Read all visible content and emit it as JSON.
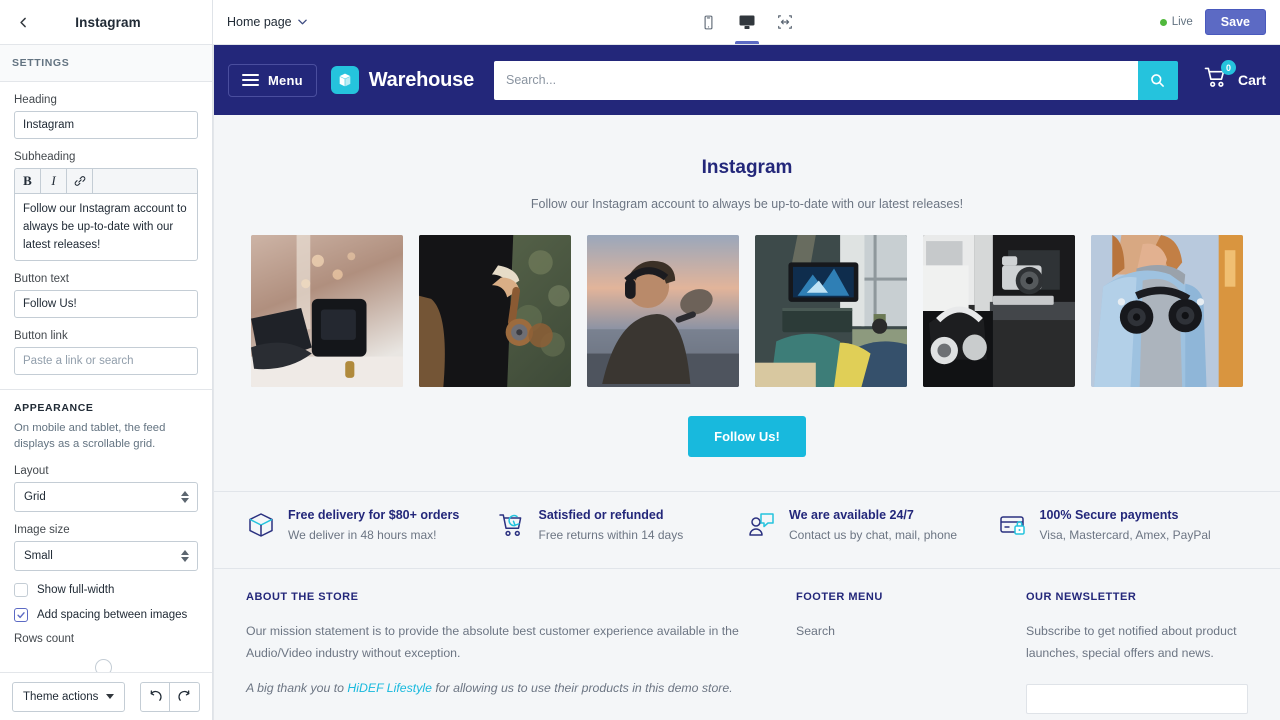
{
  "sidebar": {
    "back_icon": "chevron-left-icon",
    "title": "Instagram",
    "section_label": "SETTINGS",
    "heading": {
      "label": "Heading",
      "value": "Instagram"
    },
    "subheading": {
      "label": "Subheading",
      "toolbar": [
        {
          "name": "bold-button",
          "glyph": "B"
        },
        {
          "name": "italic-button",
          "glyph": "I"
        },
        {
          "name": "link-button",
          "glyph": "link-icon"
        }
      ],
      "value": "Follow our Instagram account to always be up-to-date with our latest releases!"
    },
    "button_text": {
      "label": "Button text",
      "value": "Follow Us!"
    },
    "button_link": {
      "label": "Button link",
      "value": "",
      "placeholder": "Paste a link or search"
    },
    "appearance": {
      "label": "APPEARANCE",
      "help": "On mobile and tablet, the feed displays as a scrollable grid.",
      "layout": {
        "label": "Layout",
        "value": "Grid"
      },
      "image_size": {
        "label": "Image size",
        "value": "Small"
      },
      "show_full_width": {
        "label": "Show full-width",
        "checked": false
      },
      "add_spacing": {
        "label": "Add spacing between images",
        "checked": true
      },
      "rows_count": {
        "label": "Rows count"
      }
    },
    "footer": {
      "theme_actions": "Theme actions",
      "undo": "undo-icon",
      "redo": "redo-icon"
    }
  },
  "topbar": {
    "page_picker": "Home page",
    "devices": [
      {
        "name": "mobile",
        "active": false
      },
      {
        "name": "desktop",
        "active": true
      },
      {
        "name": "full-width",
        "active": false
      }
    ],
    "live_label": "Live",
    "live_color": "#50b83c",
    "save_label": "Save",
    "save_color": "#5c6ac4"
  },
  "store": {
    "header": {
      "bg_color": "#23277a",
      "accent_color": "#25c3dd",
      "menu_label": "Menu",
      "brand_name": "Warehouse",
      "search_placeholder": "Search...",
      "search_value": "",
      "cart_label": "Cart",
      "cart_count": "0"
    },
    "instagram": {
      "title": "Instagram",
      "subtitle": "Follow our Instagram account to always be up-to-date with our latest releases!",
      "button_label": "Follow Us!",
      "button_color": "#18b9dd",
      "images": [
        {
          "alt": "black-marshall-headphones-on-table"
        },
        {
          "alt": "person-holding-wooden-headphones"
        },
        {
          "alt": "man-with-headphones-and-boom-mic-at-sunset"
        },
        {
          "alt": "people-watching-tv-in-living-room"
        },
        {
          "alt": "headphones-and-camera-on-desk"
        },
        {
          "alt": "woman-in-blue-jacket-with-headphones"
        }
      ]
    },
    "benefits": [
      {
        "icon": "box-icon",
        "title": "Free delivery for $80+ orders",
        "subtitle": "We deliver in 48 hours max!"
      },
      {
        "icon": "cart-return-icon",
        "title": "Satisfied or refunded",
        "subtitle": "Free returns within 14 days"
      },
      {
        "icon": "support-chat-icon",
        "title": "We are available 24/7",
        "subtitle": "Contact us by chat, mail, phone"
      },
      {
        "icon": "secure-card-icon",
        "title": "100% Secure payments",
        "subtitle": "Visa, Mastercard, Amex, PayPal"
      }
    ],
    "footer": {
      "about": {
        "heading": "ABOUT THE STORE",
        "body": "Our mission statement is to provide the absolute best customer experience available in the Audio/Video industry without exception.",
        "credit_prefix": "A big thank you to ",
        "credit_link": "HiDEF Lifestyle",
        "credit_suffix": " for allowing us to use their products in this demo store."
      },
      "menu": {
        "heading": "FOOTER MENU",
        "items": [
          "Search"
        ]
      },
      "newsletter": {
        "heading": "OUR NEWSLETTER",
        "body": "Subscribe to get notified about product launches, special offers and news.",
        "input_value": ""
      }
    }
  }
}
